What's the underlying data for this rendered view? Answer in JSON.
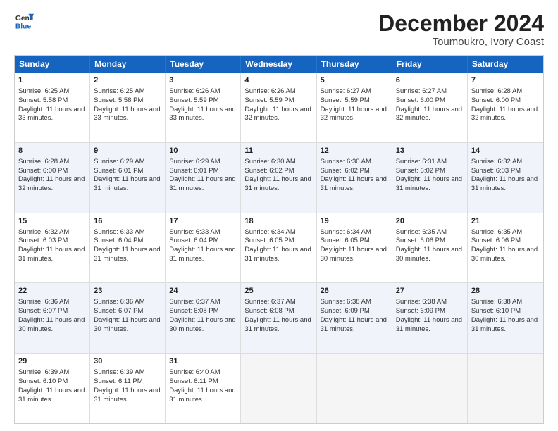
{
  "logo": {
    "general": "General",
    "blue": "Blue"
  },
  "title": "December 2024",
  "subtitle": "Toumoukro, Ivory Coast",
  "header_days": [
    "Sunday",
    "Monday",
    "Tuesday",
    "Wednesday",
    "Thursday",
    "Friday",
    "Saturday"
  ],
  "rows": [
    [
      {
        "day": "1",
        "sunrise": "Sunrise: 6:25 AM",
        "sunset": "Sunset: 5:58 PM",
        "daylight": "Daylight: 11 hours and 33 minutes."
      },
      {
        "day": "2",
        "sunrise": "Sunrise: 6:25 AM",
        "sunset": "Sunset: 5:58 PM",
        "daylight": "Daylight: 11 hours and 33 minutes."
      },
      {
        "day": "3",
        "sunrise": "Sunrise: 6:26 AM",
        "sunset": "Sunset: 5:59 PM",
        "daylight": "Daylight: 11 hours and 33 minutes."
      },
      {
        "day": "4",
        "sunrise": "Sunrise: 6:26 AM",
        "sunset": "Sunset: 5:59 PM",
        "daylight": "Daylight: 11 hours and 32 minutes."
      },
      {
        "day": "5",
        "sunrise": "Sunrise: 6:27 AM",
        "sunset": "Sunset: 5:59 PM",
        "daylight": "Daylight: 11 hours and 32 minutes."
      },
      {
        "day": "6",
        "sunrise": "Sunrise: 6:27 AM",
        "sunset": "Sunset: 6:00 PM",
        "daylight": "Daylight: 11 hours and 32 minutes."
      },
      {
        "day": "7",
        "sunrise": "Sunrise: 6:28 AM",
        "sunset": "Sunset: 6:00 PM",
        "daylight": "Daylight: 11 hours and 32 minutes."
      }
    ],
    [
      {
        "day": "8",
        "sunrise": "Sunrise: 6:28 AM",
        "sunset": "Sunset: 6:00 PM",
        "daylight": "Daylight: 11 hours and 32 minutes."
      },
      {
        "day": "9",
        "sunrise": "Sunrise: 6:29 AM",
        "sunset": "Sunset: 6:01 PM",
        "daylight": "Daylight: 11 hours and 31 minutes."
      },
      {
        "day": "10",
        "sunrise": "Sunrise: 6:29 AM",
        "sunset": "Sunset: 6:01 PM",
        "daylight": "Daylight: 11 hours and 31 minutes."
      },
      {
        "day": "11",
        "sunrise": "Sunrise: 6:30 AM",
        "sunset": "Sunset: 6:02 PM",
        "daylight": "Daylight: 11 hours and 31 minutes."
      },
      {
        "day": "12",
        "sunrise": "Sunrise: 6:30 AM",
        "sunset": "Sunset: 6:02 PM",
        "daylight": "Daylight: 11 hours and 31 minutes."
      },
      {
        "day": "13",
        "sunrise": "Sunrise: 6:31 AM",
        "sunset": "Sunset: 6:02 PM",
        "daylight": "Daylight: 11 hours and 31 minutes."
      },
      {
        "day": "14",
        "sunrise": "Sunrise: 6:32 AM",
        "sunset": "Sunset: 6:03 PM",
        "daylight": "Daylight: 11 hours and 31 minutes."
      }
    ],
    [
      {
        "day": "15",
        "sunrise": "Sunrise: 6:32 AM",
        "sunset": "Sunset: 6:03 PM",
        "daylight": "Daylight: 11 hours and 31 minutes."
      },
      {
        "day": "16",
        "sunrise": "Sunrise: 6:33 AM",
        "sunset": "Sunset: 6:04 PM",
        "daylight": "Daylight: 11 hours and 31 minutes."
      },
      {
        "day": "17",
        "sunrise": "Sunrise: 6:33 AM",
        "sunset": "Sunset: 6:04 PM",
        "daylight": "Daylight: 11 hours and 31 minutes."
      },
      {
        "day": "18",
        "sunrise": "Sunrise: 6:34 AM",
        "sunset": "Sunset: 6:05 PM",
        "daylight": "Daylight: 11 hours and 31 minutes."
      },
      {
        "day": "19",
        "sunrise": "Sunrise: 6:34 AM",
        "sunset": "Sunset: 6:05 PM",
        "daylight": "Daylight: 11 hours and 30 minutes."
      },
      {
        "day": "20",
        "sunrise": "Sunrise: 6:35 AM",
        "sunset": "Sunset: 6:06 PM",
        "daylight": "Daylight: 11 hours and 30 minutes."
      },
      {
        "day": "21",
        "sunrise": "Sunrise: 6:35 AM",
        "sunset": "Sunset: 6:06 PM",
        "daylight": "Daylight: 11 hours and 30 minutes."
      }
    ],
    [
      {
        "day": "22",
        "sunrise": "Sunrise: 6:36 AM",
        "sunset": "Sunset: 6:07 PM",
        "daylight": "Daylight: 11 hours and 30 minutes."
      },
      {
        "day": "23",
        "sunrise": "Sunrise: 6:36 AM",
        "sunset": "Sunset: 6:07 PM",
        "daylight": "Daylight: 11 hours and 30 minutes."
      },
      {
        "day": "24",
        "sunrise": "Sunrise: 6:37 AM",
        "sunset": "Sunset: 6:08 PM",
        "daylight": "Daylight: 11 hours and 30 minutes."
      },
      {
        "day": "25",
        "sunrise": "Sunrise: 6:37 AM",
        "sunset": "Sunset: 6:08 PM",
        "daylight": "Daylight: 11 hours and 31 minutes."
      },
      {
        "day": "26",
        "sunrise": "Sunrise: 6:38 AM",
        "sunset": "Sunset: 6:09 PM",
        "daylight": "Daylight: 11 hours and 31 minutes."
      },
      {
        "day": "27",
        "sunrise": "Sunrise: 6:38 AM",
        "sunset": "Sunset: 6:09 PM",
        "daylight": "Daylight: 11 hours and 31 minutes."
      },
      {
        "day": "28",
        "sunrise": "Sunrise: 6:38 AM",
        "sunset": "Sunset: 6:10 PM",
        "daylight": "Daylight: 11 hours and 31 minutes."
      }
    ],
    [
      {
        "day": "29",
        "sunrise": "Sunrise: 6:39 AM",
        "sunset": "Sunset: 6:10 PM",
        "daylight": "Daylight: 11 hours and 31 minutes."
      },
      {
        "day": "30",
        "sunrise": "Sunrise: 6:39 AM",
        "sunset": "Sunset: 6:11 PM",
        "daylight": "Daylight: 11 hours and 31 minutes."
      },
      {
        "day": "31",
        "sunrise": "Sunrise: 6:40 AM",
        "sunset": "Sunset: 6:11 PM",
        "daylight": "Daylight: 11 hours and 31 minutes."
      },
      null,
      null,
      null,
      null
    ]
  ],
  "alt_rows": [
    1,
    3
  ],
  "colors": {
    "header_bg": "#1565c0",
    "header_text": "#ffffff",
    "alt_row_bg": "#eef2f8",
    "empty_bg": "#f5f5f5",
    "border": "#cccccc"
  }
}
